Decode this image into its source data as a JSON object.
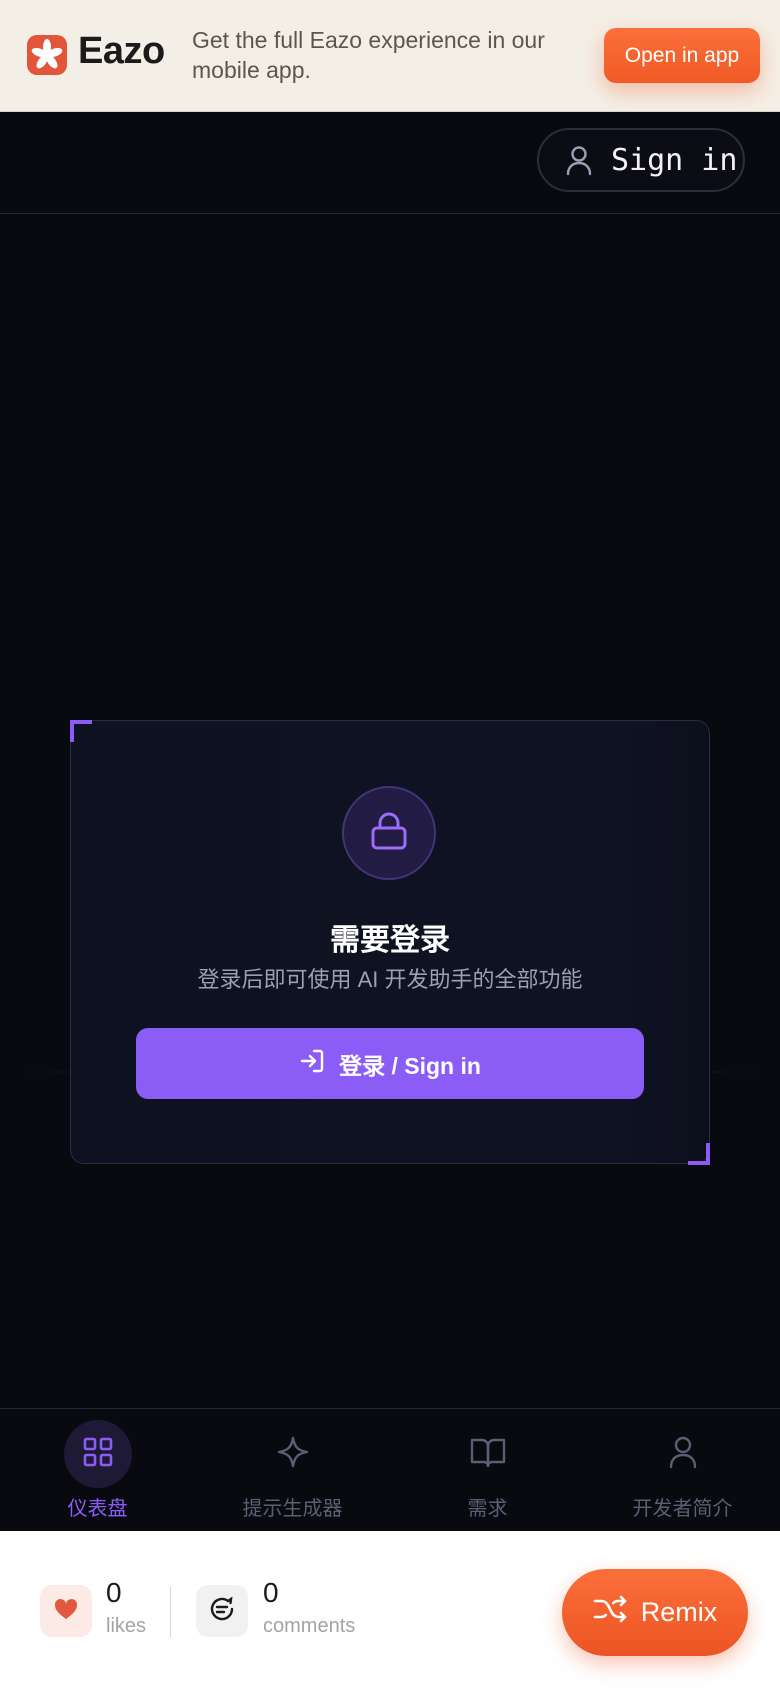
{
  "banner": {
    "brand": "Eazo",
    "promo": "Get the full Eazo experience in our mobile app.",
    "open_label": "Open in app",
    "logo_icon": "eazo-logo-icon",
    "accent": "#ef5a26"
  },
  "header": {
    "signin_label": "Sign in",
    "signin_icon": "user-icon"
  },
  "card": {
    "icon": "lock-icon",
    "title": "需要登录",
    "subtitle": "登录后即可使用 AI 开发助手的全部功能",
    "button_label": "登录 / Sign in",
    "button_icon": "log-in-icon",
    "accent": "#8b5cf6"
  },
  "nav": {
    "items": [
      {
        "label": "仪表盘",
        "icon": "dashboard-grid-icon",
        "active": true
      },
      {
        "label": "提示生成器",
        "icon": "sparkle-icon",
        "active": false
      },
      {
        "label": "需求",
        "icon": "book-open-icon",
        "active": false
      },
      {
        "label": "开发者简介",
        "icon": "user-icon",
        "active": false
      }
    ]
  },
  "footer": {
    "likes_count": "0",
    "likes_label": "likes",
    "comments_count": "0",
    "comments_label": "comments",
    "remix_label": "Remix",
    "likes_icon": "heart-icon",
    "comments_icon": "comment-icon",
    "remix_icon": "shuffle-icon"
  }
}
